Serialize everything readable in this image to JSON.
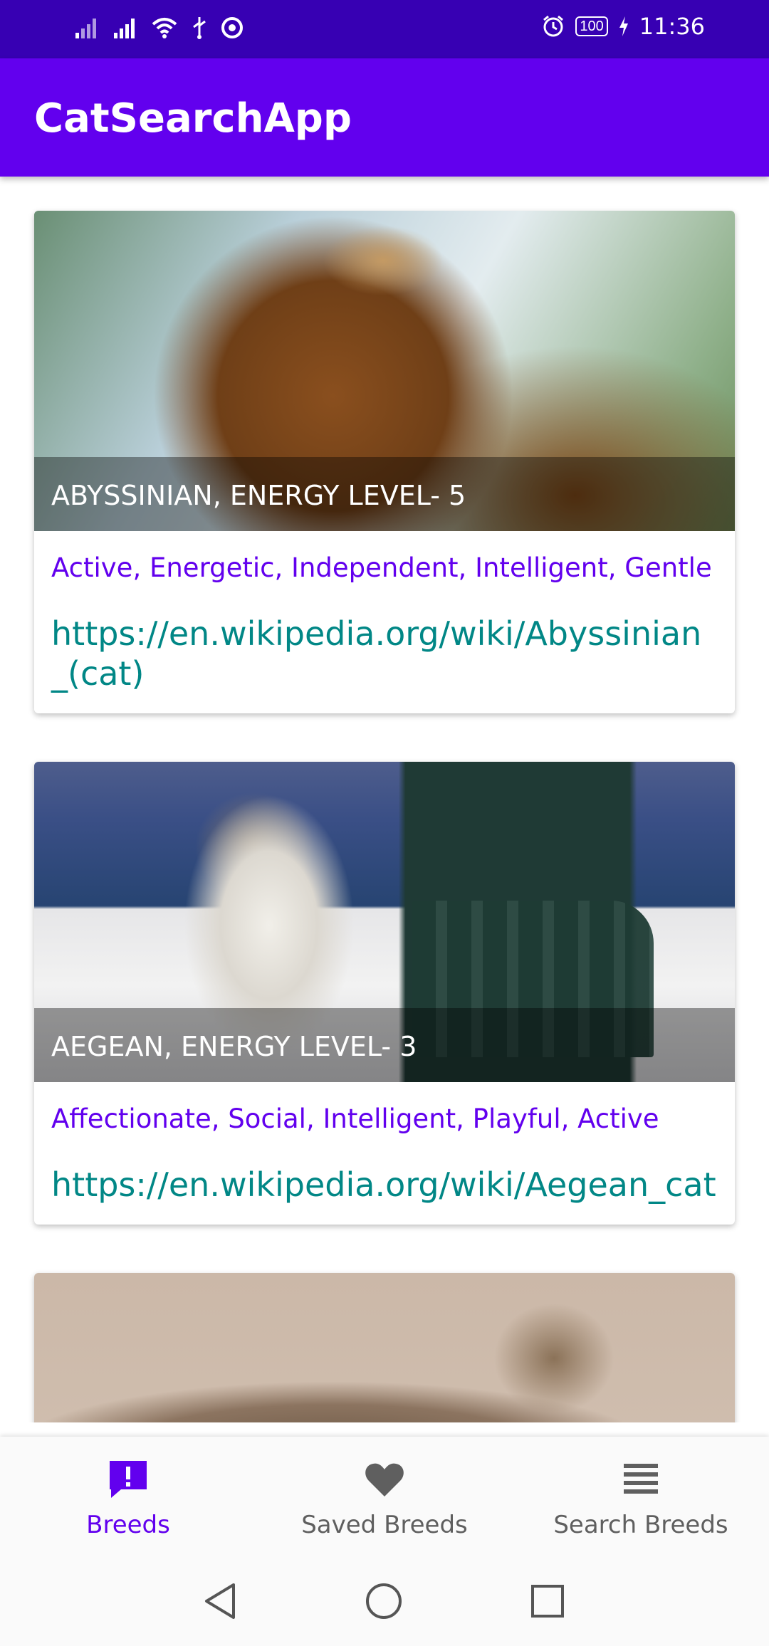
{
  "status_bar": {
    "time": "11:36",
    "battery": "100",
    "icons": [
      "signal-icon",
      "signal-icon-2",
      "wifi-icon",
      "usb-icon",
      "chrome-icon",
      "alarm-icon",
      "battery-icon",
      "charging-icon"
    ]
  },
  "app_bar": {
    "title": "CatSearchApp"
  },
  "breeds": [
    {
      "caption": "ABYSSINIAN, ENERGY LEVEL- 5",
      "temperament": "Active, Energetic, Independent, Intelligent, Gentle",
      "wiki_url": "https://en.wikipedia.org/wiki/Abyssinian_(cat)"
    },
    {
      "caption": "AEGEAN, ENERGY LEVEL- 3",
      "temperament": "Affectionate, Social, Intelligent, Playful, Active",
      "wiki_url": "https://en.wikipedia.org/wiki/Aegean_cat"
    }
  ],
  "bottom_nav": {
    "items": [
      {
        "label": "Breeds",
        "icon": "breeds-alert-icon",
        "active": true
      },
      {
        "label": "Saved Breeds",
        "icon": "heart-icon",
        "active": false
      },
      {
        "label": "Search Breeds",
        "icon": "list-icon",
        "active": false
      }
    ]
  },
  "colors": {
    "primary": "#6200EE",
    "primary_dark": "#3700B3",
    "teal": "#018786"
  }
}
